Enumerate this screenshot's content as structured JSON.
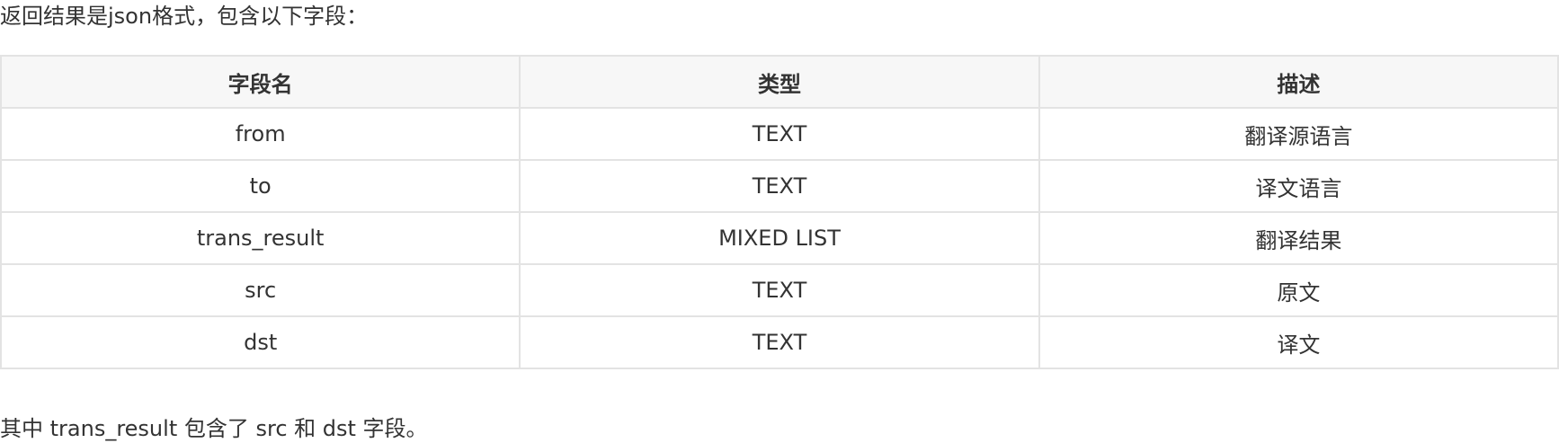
{
  "intro_text": "返回结果是json格式，包含以下字段：",
  "table": {
    "headers": [
      "字段名",
      "类型",
      "描述"
    ],
    "rows": [
      [
        "from",
        "TEXT",
        "翻译源语言"
      ],
      [
        "to",
        "TEXT",
        "译文语言"
      ],
      [
        "trans_result",
        "MIXED LIST",
        "翻译结果"
      ],
      [
        "src",
        "TEXT",
        "原文"
      ],
      [
        "dst",
        "TEXT",
        "译文"
      ]
    ]
  },
  "footer_text": "其中 trans_result 包含了 src 和 dst 字段。",
  "colors": {
    "text": "#333333",
    "header_bg": "#f7f7f7",
    "border": "#e3e3e3"
  }
}
